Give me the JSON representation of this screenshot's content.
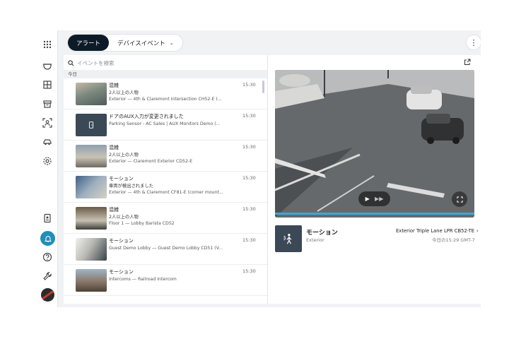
{
  "tabs": [
    {
      "label": "アラート",
      "active": true
    },
    {
      "label": "デバイスイベント",
      "active": false
    }
  ],
  "search": {
    "placeholder": "イベントを検索"
  },
  "section_label": "今日",
  "events": [
    {
      "title": "混雑",
      "subtitle": "2人以上の人物",
      "location": "Exterior — 4th & Claremont Intersection CH52-E (...",
      "time": "15:30",
      "thumb": "camera"
    },
    {
      "title": "ドアのAUX入力が変更されました",
      "subtitle": "",
      "location": "Parking Sensor - AC Sales | AUX Monitors Demo (...",
      "time": "15:30",
      "thumb": "device"
    },
    {
      "title": "混雑",
      "subtitle": "2人以上の人物",
      "location": "Exterior — Claremont Exterior CD52-E",
      "time": "15:30",
      "thumb": "camera"
    },
    {
      "title": "モーション",
      "subtitle": "車両が検出されました",
      "location": "Exterior — 4th & Claremont CF81-E (corner mount...",
      "time": "15:30",
      "thumb": "camera"
    },
    {
      "title": "混雑",
      "subtitle": "2人以上の人物",
      "location": "Floor 1 — Lobby Barista CD52",
      "time": "15:30",
      "thumb": "camera"
    },
    {
      "title": "モーション",
      "subtitle": "",
      "location": "Guest Demo Lobby — Guest Demo Lobby CD51 (V...",
      "time": "15:30",
      "thumb": "camera"
    },
    {
      "title": "モーション",
      "subtitle": "",
      "location": "Intercoms — Railroad Intercom",
      "time": "15:30",
      "thumb": "camera"
    }
  ],
  "detail": {
    "title": "モーション",
    "subtitle": "Exterior",
    "camera": "Exterior Triple Lane LPR CB52-TE",
    "timestamp": "今日の15:29 GMT-7"
  },
  "icons": {
    "rail": [
      "grid-icon",
      "camera-dome-icon",
      "layout-icon",
      "archive-icon",
      "person-scan-icon",
      "vehicle-icon",
      "gear-icon",
      "badge-icon",
      "bell-icon",
      "help-icon",
      "wrench-icon"
    ],
    "search": "search-icon",
    "share": "share-icon",
    "fullscreen": "fullscreen-icon",
    "motion": "person-motion-icon"
  },
  "colors": {
    "accent": "#1f8fb8",
    "progress": "#3fa6d8",
    "active_tab": "#0d1b29"
  }
}
